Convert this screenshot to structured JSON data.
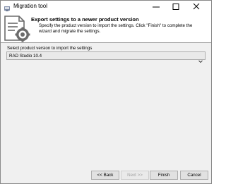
{
  "window": {
    "title": "Migration tool",
    "icons": {
      "app": "migration-tool-app-icon",
      "minimize": "minimize-icon",
      "maximize": "maximize-icon",
      "close": "close-icon"
    }
  },
  "header": {
    "icon": "settings-document-icon",
    "title": "Export settings to a newer product version",
    "description": "Specify the product version to import the settings. Click \"Finish\" to complete the wizard and migrate the settings."
  },
  "form": {
    "select_label": "Select product version to import the settings",
    "selected_version": "RAD Studio 10.4"
  },
  "buttons": {
    "back": "<< Back",
    "next": "Next >>",
    "next_enabled": false,
    "finish": "Finish",
    "cancel": "Cancel"
  },
  "colors": {
    "window_bg": "#f0f0f0",
    "header_bg": "#ffffff",
    "button_bg": "#e1e1e1",
    "disabled_text": "#a0a0a0"
  }
}
